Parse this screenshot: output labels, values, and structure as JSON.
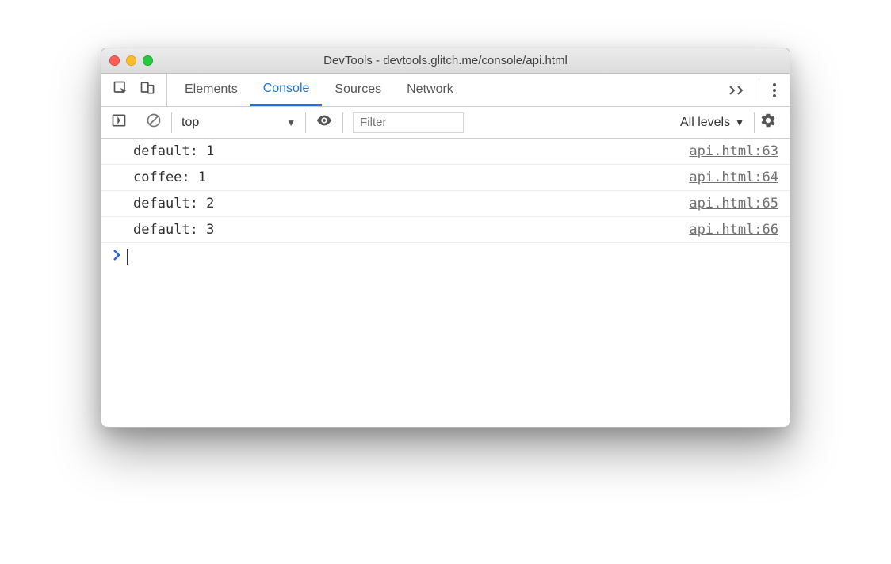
{
  "window": {
    "title": "DevTools - devtools.glitch.me/console/api.html"
  },
  "tabs": {
    "items": [
      "Elements",
      "Console",
      "Sources",
      "Network"
    ],
    "active_index": 1
  },
  "console_toolbar": {
    "context": "top",
    "filter_placeholder": "Filter",
    "levels_label": "All levels"
  },
  "logs": [
    {
      "message": "default: 1",
      "source": "api.html:63"
    },
    {
      "message": "coffee: 1",
      "source": "api.html:64"
    },
    {
      "message": "default: 2",
      "source": "api.html:65"
    },
    {
      "message": "default: 3",
      "source": "api.html:66"
    }
  ]
}
